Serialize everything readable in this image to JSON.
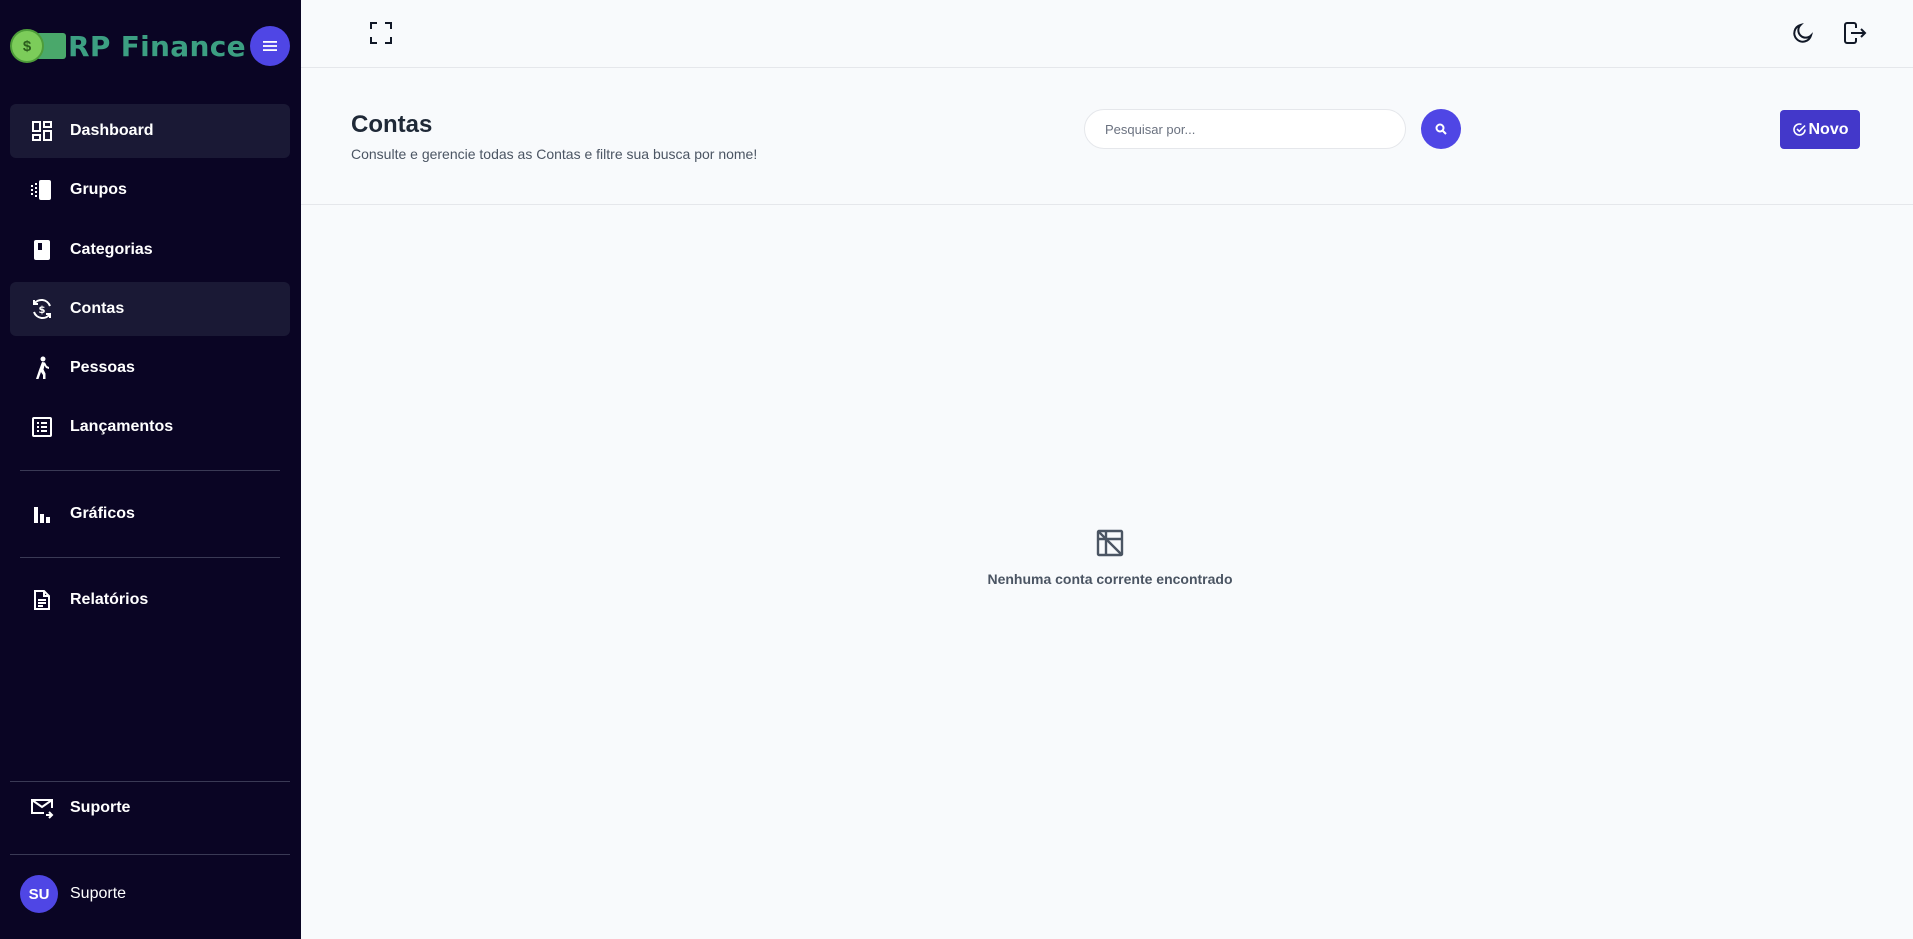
{
  "app": {
    "logo_text": "RP Finance",
    "logo_coin": "$"
  },
  "sidebar": {
    "items": [
      {
        "label": "Dashboard",
        "icon": "dashboard-icon"
      },
      {
        "label": "Grupos",
        "icon": "groups-icon"
      },
      {
        "label": "Categorias",
        "icon": "book-icon"
      },
      {
        "label": "Contas",
        "icon": "currency-exchange-icon"
      },
      {
        "label": "Pessoas",
        "icon": "walking-person-icon"
      },
      {
        "label": "Lançamentos",
        "icon": "list-icon"
      },
      {
        "label": "Gráficos",
        "icon": "bar-chart-icon"
      },
      {
        "label": "Relatórios",
        "icon": "document-icon"
      }
    ],
    "support": {
      "label": "Suporte",
      "icon": "mail-icon"
    },
    "user": {
      "initials": "SU",
      "name": "Suporte"
    }
  },
  "page": {
    "title": "Contas",
    "subtitle": "Consulte e gerencie todas as Contas e filtre sua busca por nome!",
    "search_placeholder": "Pesquisar por...",
    "new_label": "Novo",
    "empty_message": "Nenhuma conta corrente encontrado"
  },
  "colors": {
    "sidebar_bg": "#0a0524",
    "accent": "#4f46e5",
    "active_item_bg": "#1a1935"
  }
}
